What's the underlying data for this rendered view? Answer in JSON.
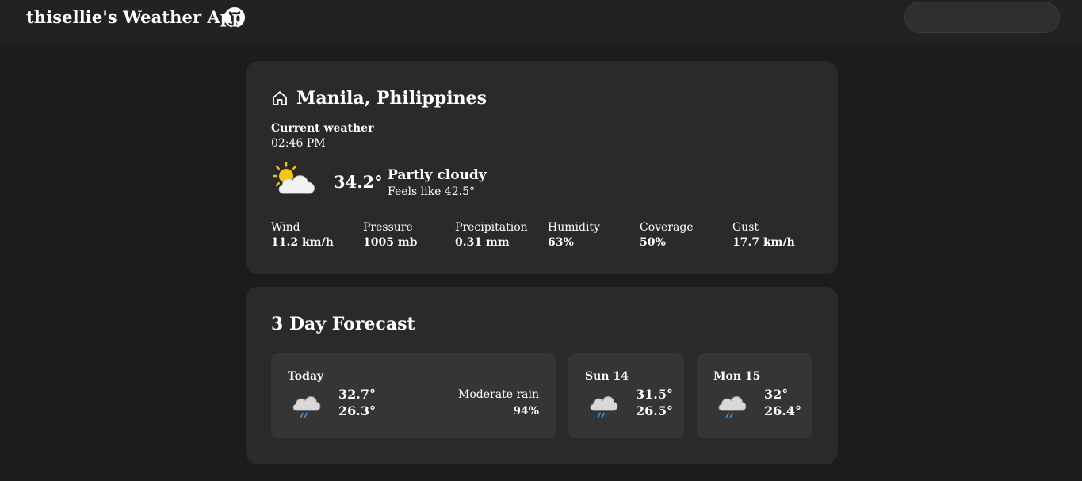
{
  "header": {
    "title": "thisellie's Weather App",
    "github_icon": "github-icon",
    "search_placeholder": ""
  },
  "current": {
    "location": "Manila, Philippines",
    "location_icon": "home-icon",
    "label": "Current weather",
    "time": "02:46 PM",
    "icon": "partly-cloudy-icon",
    "temperature": "34.2°",
    "condition": "Partly cloudy",
    "feels_like": "Feels like 42.5°",
    "stats": [
      {
        "label": "Wind",
        "value": "11.2 km/h"
      },
      {
        "label": "Pressure",
        "value": "1005 mb"
      },
      {
        "label": "Precipitation",
        "value": "0.31 mm"
      },
      {
        "label": "Humidity",
        "value": "63%"
      },
      {
        "label": "Coverage",
        "value": "50%"
      },
      {
        "label": "Gust",
        "value": "17.7 km/h"
      }
    ]
  },
  "forecast": {
    "title": "3 Day Forecast",
    "days": [
      {
        "name": "Today",
        "icon": "rain-cloud-icon",
        "high": "32.7°",
        "low": "26.3°",
        "condition": "Moderate rain",
        "chance": "94%"
      },
      {
        "name": "Sun 14",
        "icon": "rain-cloud-icon",
        "high": "31.5°",
        "low": "26.5°"
      },
      {
        "name": "Mon 15",
        "icon": "rain-cloud-icon",
        "high": "32°",
        "low": "26.4°"
      }
    ]
  },
  "colors": {
    "background": "#1c1c1c",
    "header": "#222222",
    "card": "#2a2a2a",
    "tile": "#353535",
    "sun": "#f5c518",
    "rain": "#3b8fd9"
  }
}
